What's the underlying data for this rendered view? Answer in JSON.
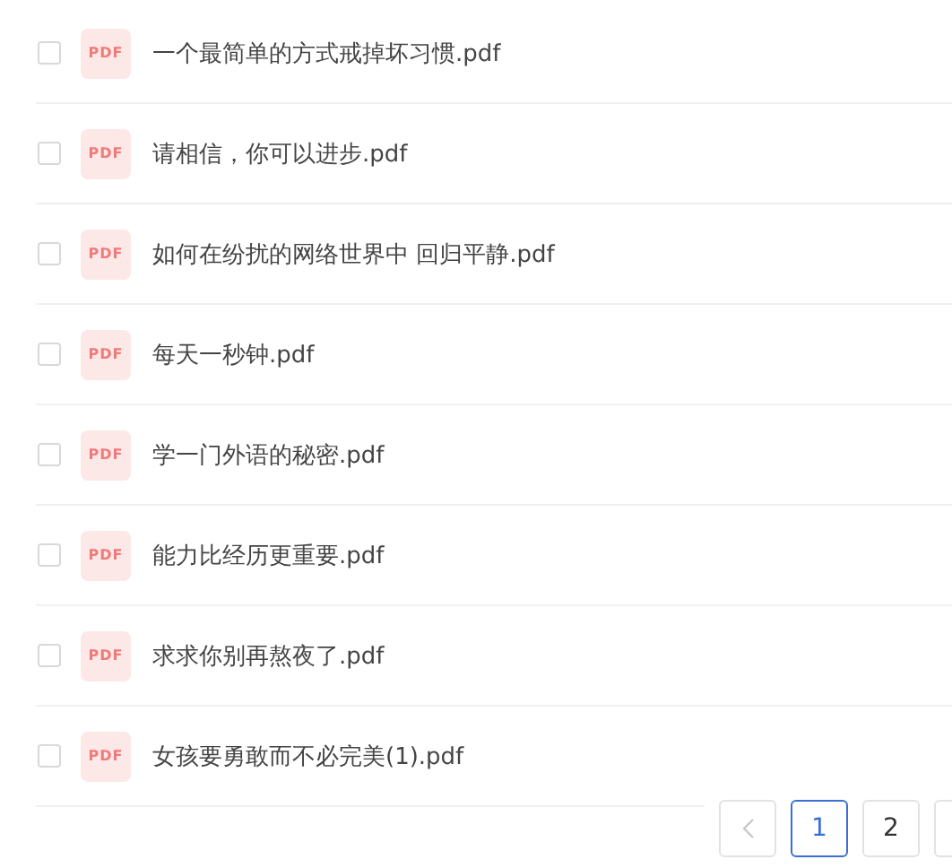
{
  "files": [
    {
      "icon_label": "PDF",
      "name": "一个最简单的方式戒掉坏习惯.pdf",
      "checked": false
    },
    {
      "icon_label": "PDF",
      "name": "请相信，你可以进步.pdf",
      "checked": false
    },
    {
      "icon_label": "PDF",
      "name": "如何在纷扰的网络世界中 回归平静.pdf",
      "checked": false
    },
    {
      "icon_label": "PDF",
      "name": "每天一秒钟.pdf",
      "checked": false
    },
    {
      "icon_label": "PDF",
      "name": "学一门外语的秘密.pdf",
      "checked": false
    },
    {
      "icon_label": "PDF",
      "name": "能力比经历更重要.pdf",
      "checked": false
    },
    {
      "icon_label": "PDF",
      "name": "求求你别再熬夜了.pdf",
      "checked": false
    },
    {
      "icon_label": "PDF",
      "name": "女孩要勇敢而不必完美(1).pdf",
      "checked": false
    }
  ],
  "pagination": {
    "pages": [
      {
        "label": "1",
        "selected": true
      },
      {
        "label": "2",
        "selected": false
      }
    ]
  }
}
